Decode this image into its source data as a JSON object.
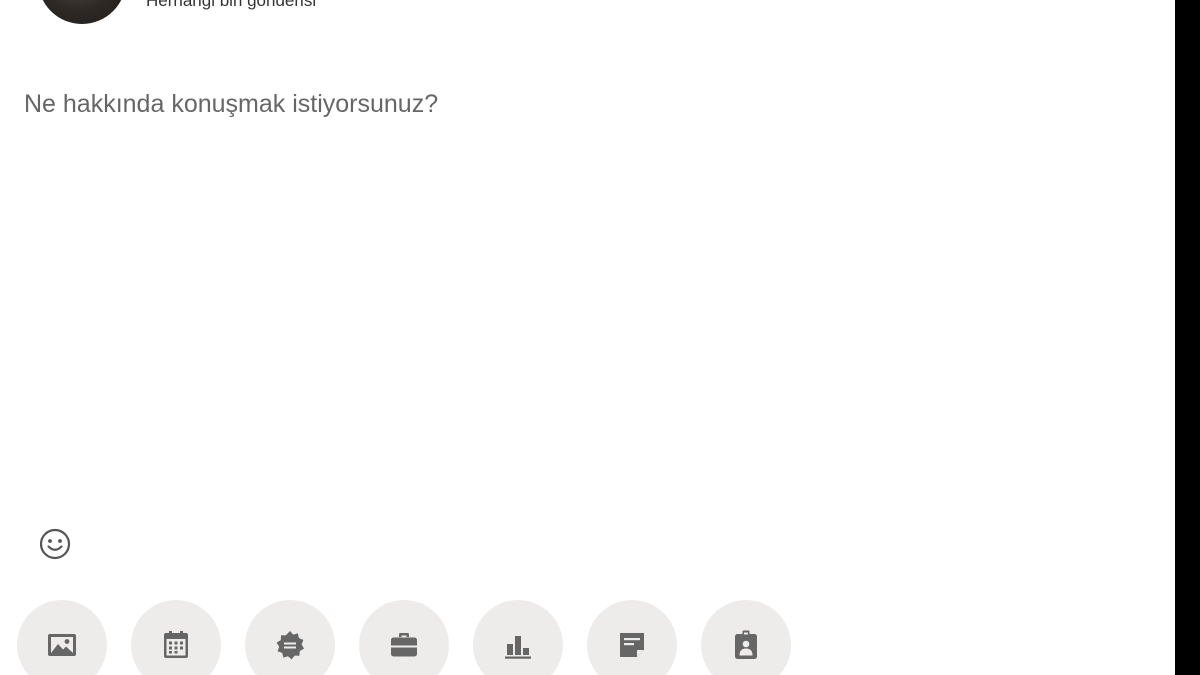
{
  "author": {
    "visibility_label": "Herhangi biri gönderisi"
  },
  "composer": {
    "placeholder": "Ne hakkında konuşmak istiyorsunuz?"
  },
  "toolbar": {
    "emoji_icon": "smiley-icon",
    "buttons": [
      {
        "name": "add-media-button",
        "icon": "image-icon"
      },
      {
        "name": "create-event-button",
        "icon": "calendar-icon"
      },
      {
        "name": "celebrate-button",
        "icon": "badge-icon"
      },
      {
        "name": "job-post-button",
        "icon": "briefcase-icon"
      },
      {
        "name": "poll-button",
        "icon": "bar-chart-icon"
      },
      {
        "name": "document-button",
        "icon": "document-icon"
      },
      {
        "name": "service-button",
        "icon": "id-badge-icon"
      }
    ]
  },
  "colors": {
    "icon": "#666666",
    "button_bg": "#eeeceb",
    "placeholder_text": "#666666"
  }
}
